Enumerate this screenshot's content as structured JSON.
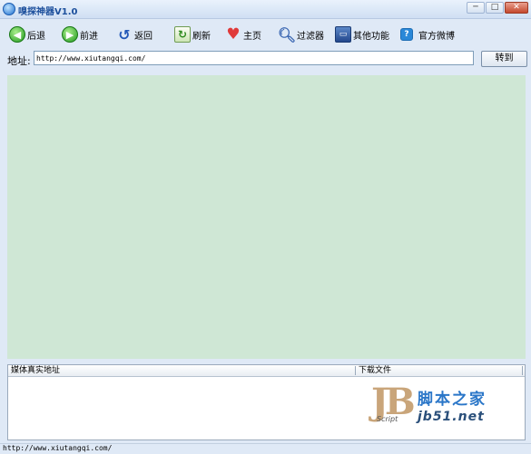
{
  "window": {
    "title": "嗅探神器V1.0"
  },
  "toolbar": {
    "items": [
      {
        "label": "后退",
        "icon": "back-arrow-icon"
      },
      {
        "label": "前进",
        "icon": "forward-arrow-icon"
      },
      {
        "label": "返回",
        "icon": "return-icon"
      },
      {
        "label": "刷新",
        "icon": "refresh-icon"
      },
      {
        "label": "主页",
        "icon": "heart-home-icon"
      },
      {
        "label": "过滤器",
        "icon": "magnifier-icon"
      },
      {
        "label": "其他功能",
        "icon": "monitor-icon"
      },
      {
        "label": "官方微博",
        "icon": "weibo-icon"
      }
    ]
  },
  "address": {
    "label": "地址:",
    "value": "http://www.xiutangqi.com/",
    "go_label": "转到"
  },
  "media_table": {
    "columns": [
      "媒体真实地址",
      "下载文件"
    ]
  },
  "watermark": {
    "logo": "JB",
    "script": "Script",
    "site_name": "脚本之家",
    "site_url": "jb51.net"
  },
  "statusbar": {
    "text": "http://www.xiutangqi.com/"
  },
  "colors": {
    "browser_bg": "#cfe7d5",
    "chrome_bg": "#dfe9f6",
    "title_text": "#1c4f9c"
  }
}
